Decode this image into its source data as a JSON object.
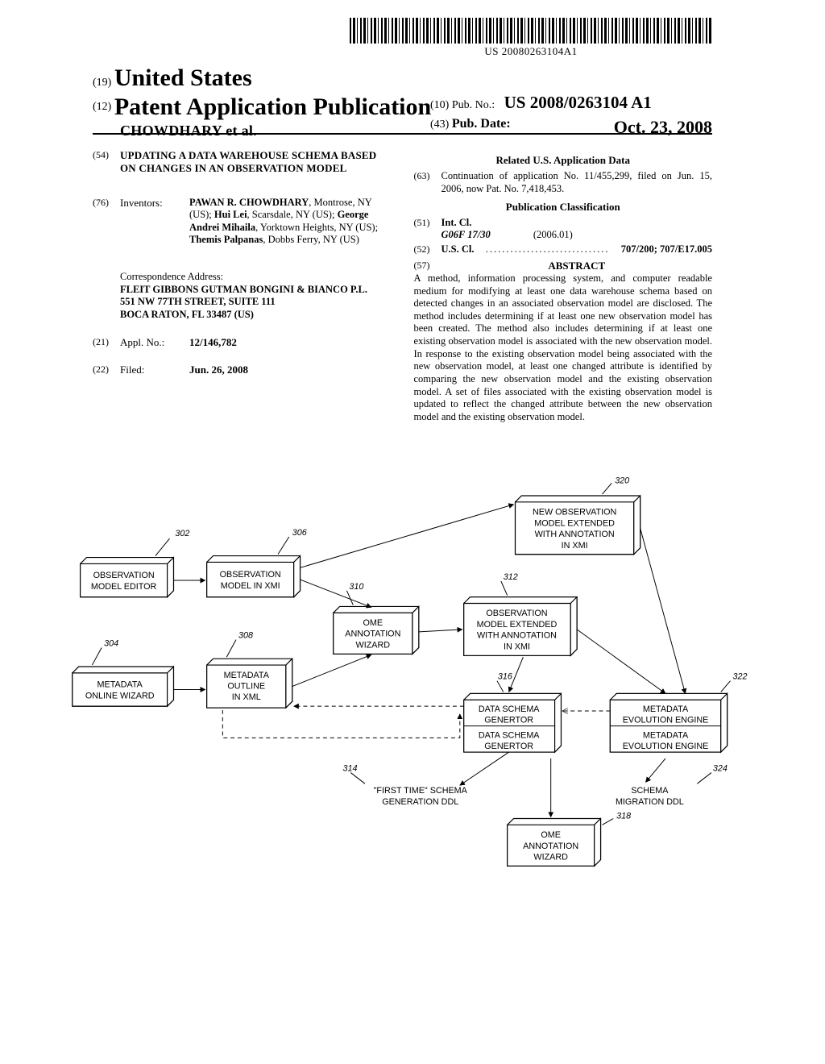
{
  "barcode_text": "US 20080263104A1",
  "hdr": {
    "c19": "(19)",
    "country": "United States",
    "c12": "(12)",
    "doc_type": "Patent Application Publication",
    "authors_line": "CHOWDHARY et al.",
    "c10": "(10)",
    "pubno_lbl": "Pub. No.:",
    "pubno": "US 2008/0263104 A1",
    "c43": "(43)",
    "pubdate_lbl": "Pub. Date:",
    "pubdate": "Oct. 23, 2008"
  },
  "left": {
    "c54": "(54)",
    "title": "UPDATING A DATA WAREHOUSE SCHEMA BASED ON CHANGES IN AN OBSERVATION MODEL",
    "c76": "(76)",
    "inventors_lbl": "Inventors:",
    "inventors_html": "PAWAN R. CHOWDHARY|, Montrose, NY (US); |Hui Lei|, Scarsdale, NY (US); |George Andrei Mihaila|, Yorktown Heights, NY (US); |Themis Palpanas|, Dobbs Ferry, NY (US)",
    "corr_lbl": "Correspondence Address:",
    "corr1": "FLEIT  GIBBONS  GUTMAN  BONGINI  & BIANCO P.L.",
    "corr2": "551 NW 77TH STREET, SUITE 111",
    "corr3": "BOCA RATON, FL 33487 (US)",
    "c21": "(21)",
    "appl_lbl": "Appl. No.:",
    "appl": "12/146,782",
    "c22": "(22)",
    "filed_lbl": "Filed:",
    "filed": "Jun. 26, 2008"
  },
  "right": {
    "related_head": "Related U.S. Application Data",
    "c63": "(63)",
    "related": "Continuation of application No. 11/455,299, filed on Jun. 15, 2006, now Pat. No. 7,418,453.",
    "pubclass_head": "Publication Classification",
    "c51": "(51)",
    "intcl_lbl": "Int. Cl.",
    "intcl_code": "G06F 17/30",
    "intcl_ver": "(2006.01)",
    "c52": "(52)",
    "uscl_lbl": "U.S. Cl.",
    "uscl_val": "707/200; 707/E17.005",
    "c57": "(57)",
    "abstract_head": "ABSTRACT",
    "abstract": "A method, information processing system, and computer readable medium for modifying at least one data warehouse schema based on detected changes in an associated observation model are disclosed. The method includes determining if at least one new observation model has been created. The method also includes determining if at least one existing observation model is associated with the new observation model. In response to the existing observation model being associated with the new observation model, at least one changed attribute is identified by comparing the new observation model and the existing observation model. A set of files associated with the existing observation model is updated to reflect the changed attribute between the new observation model and the existing observation model."
  },
  "fig": {
    "n302": "302",
    "b302a": "OBSERVATION",
    "b302b": "MODEL EDITOR",
    "n304": "304",
    "b304a": "METADATA",
    "b304b": "ONLINE WIZARD",
    "n306": "306",
    "b306a": "OBSERVATION",
    "b306b": "MODEL IN XMI",
    "n308": "308",
    "b308a": "METADATA",
    "b308b": "OUTLINE",
    "b308c": "IN XML",
    "n310": "310",
    "b310a": "OME",
    "b310b": "ANNOTATION",
    "b310c": "WIZARD",
    "n312": "312",
    "b312a": "OBSERVATION",
    "b312b": "MODEL EXTENDED",
    "b312c": "WITH ANNOTATION",
    "b312d": "IN XMI",
    "n314": "314",
    "b314": "\"FIRST TIME\" SCHEMA GENERATION DDL",
    "n316": "316",
    "b316a": "DATA SCHEMA",
    "b316b": "GENERTOR",
    "b316c": "DATA SCHEMA",
    "b316d": "GENERTOR",
    "n318": "318",
    "b318a": "OME",
    "b318b": "ANNOTATION",
    "b318c": "WIZARD",
    "n320": "320",
    "b320a": "NEW OBSERVATION",
    "b320b": "MODEL EXTENDED",
    "b320c": "WITH ANNOTATION",
    "b320d": "IN XMI",
    "n322": "322",
    "b322a": "METADATA",
    "b322b": "EVOLUTION ENGINE",
    "b322c": "METADATA",
    "b322d": "EVOLUTION ENGINE",
    "n324": "324",
    "b324a": "SCHEMA",
    "b324b": "MIGRATION DDL"
  }
}
